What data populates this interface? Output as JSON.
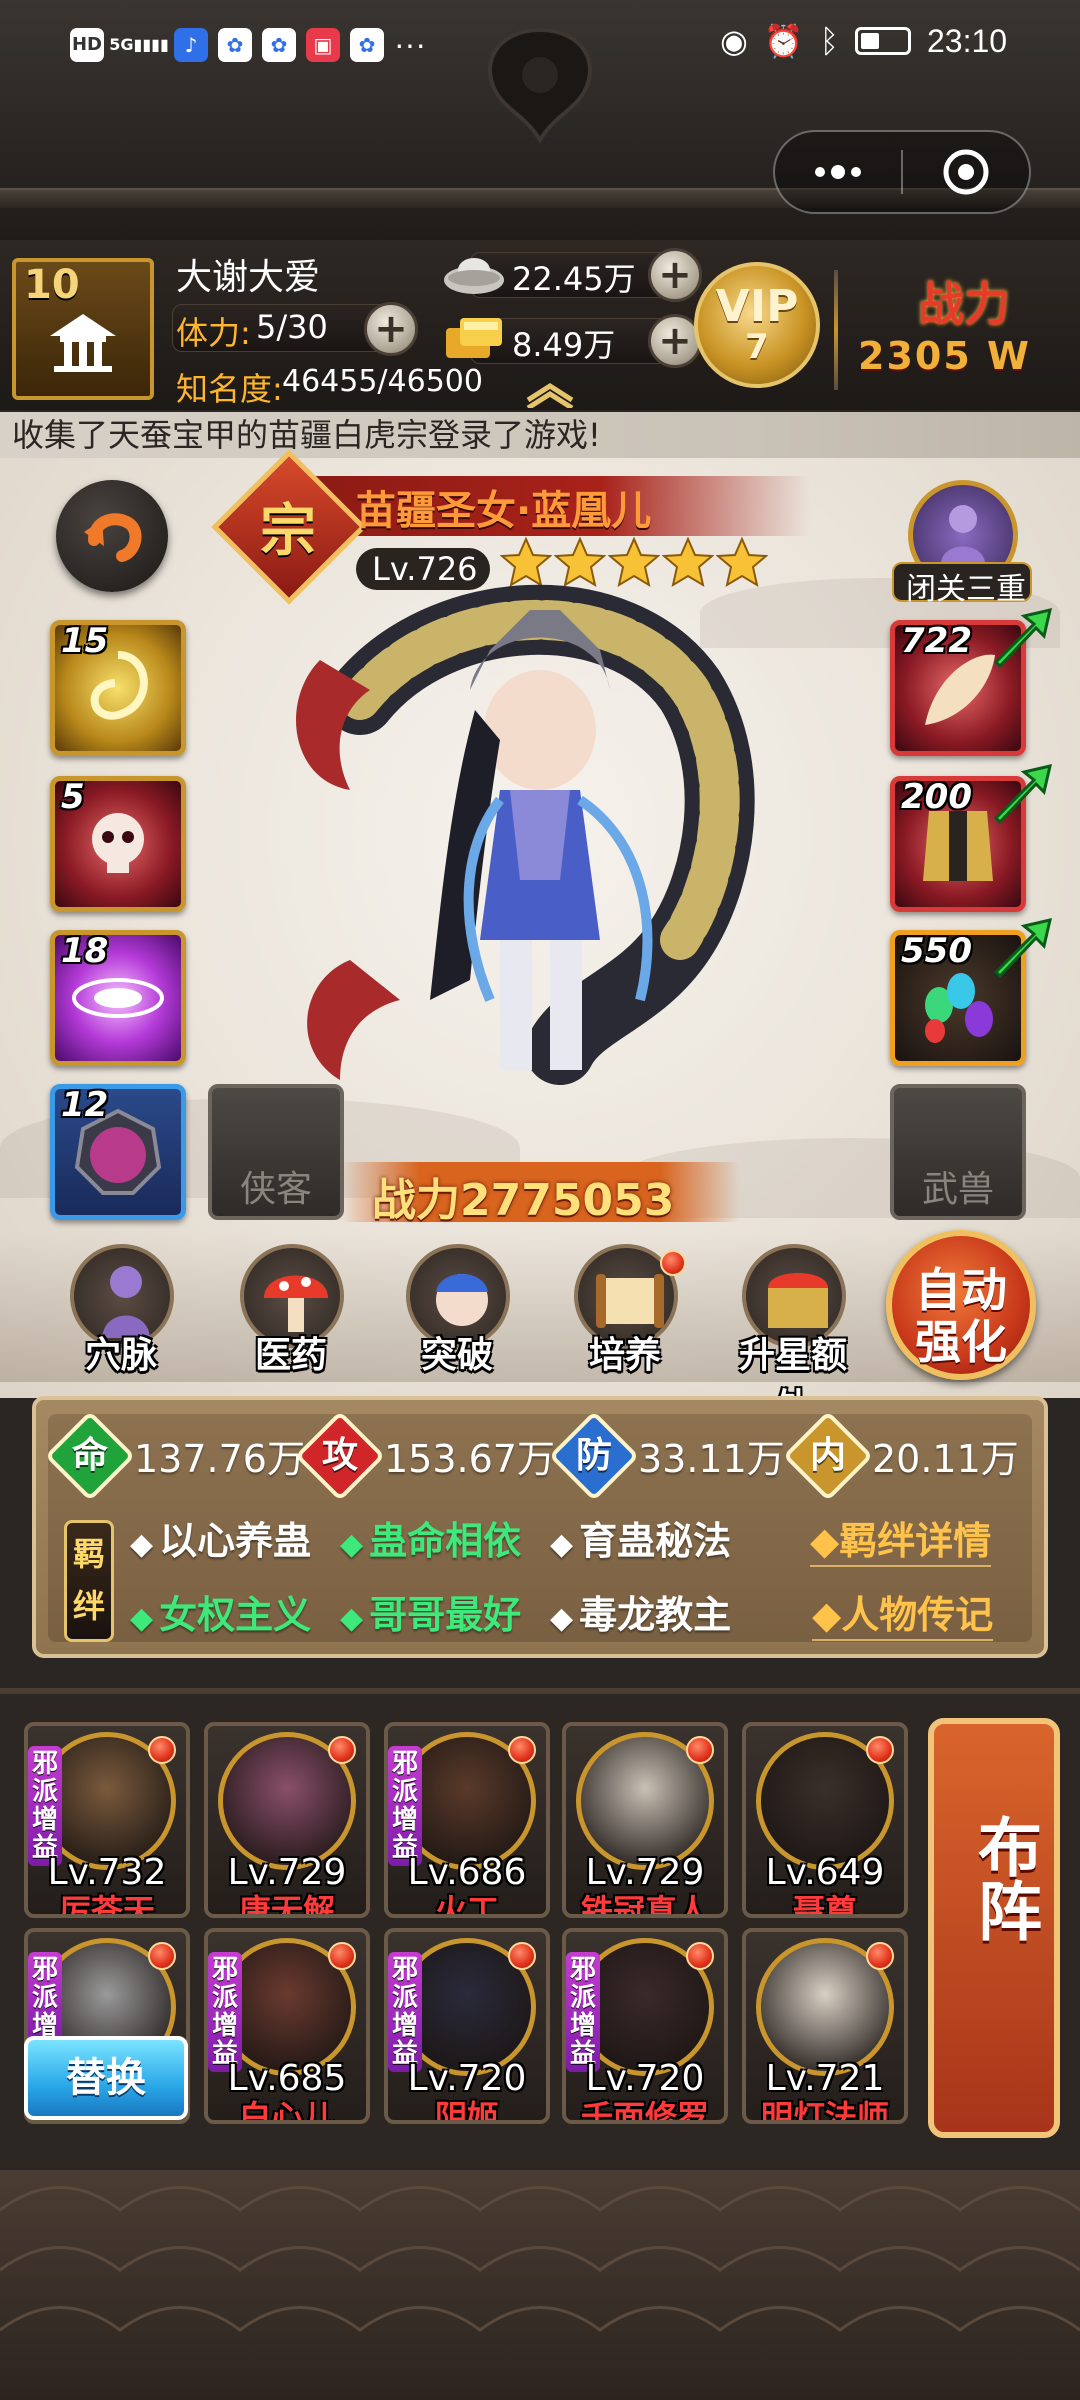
{
  "status_bar": {
    "time": "23:10",
    "left_icons": [
      "hd-icon",
      "signal-5g-icon",
      "music-app-icon",
      "baidu-paw-icon",
      "baidu-paw-icon",
      "red-app-icon",
      "baidu-paw-icon"
    ],
    "more": "···",
    "right_icons": [
      "eye-icon",
      "alarm-icon",
      "bluetooth-icon",
      "battery-icon"
    ]
  },
  "capsule": {
    "menu_icon": "more-dots-icon",
    "close_icon": "target-close-icon"
  },
  "player": {
    "level": "10",
    "name": "大谢大爱",
    "stamina_label": "体力:",
    "stamina_value": "5/30",
    "fame_label": "知名度:",
    "fame_value": "46455/46500",
    "silver": "22.45万",
    "gold": "8.49万",
    "vip_label": "VIP",
    "vip_level": "7",
    "power_label": "战力",
    "power_value": "2305 W"
  },
  "notice": "收集了天蚕宝甲的苗疆白虎宗登录了游戏!",
  "hero": {
    "badge": "宗",
    "name": "苗疆圣女·蓝凰儿",
    "level": "Lv.726",
    "stars": 5,
    "rank_label": "闭关三重",
    "power": "战力2775053"
  },
  "skills": [
    {
      "level": "15",
      "icon": "gold-swirl-icon"
    },
    {
      "level": "5",
      "icon": "skull-icon"
    },
    {
      "level": "18",
      "icon": "purple-vortex-icon"
    },
    {
      "level": "12",
      "icon": "purple-gem-medallion-icon"
    }
  ],
  "empty_slots": {
    "companion": "侠客",
    "beast": "武兽"
  },
  "equipment": [
    {
      "level": "722",
      "icon": "feather-weapon-icon"
    },
    {
      "level": "200",
      "icon": "golden-armor-icon"
    },
    {
      "level": "550",
      "icon": "gems-icon"
    }
  ],
  "features": [
    {
      "label": "穴脉",
      "icon": "meridian-figure-icon",
      "dot": false
    },
    {
      "label": "医药",
      "icon": "mushroom-icon",
      "dot": false
    },
    {
      "label": "突破",
      "icon": "warrior-head-icon",
      "dot": false
    },
    {
      "label": "培养",
      "icon": "scroll-icon",
      "dot": true
    },
    {
      "label": "升星额外",
      "icon": "treasure-icon",
      "dot": false
    }
  ],
  "auto_strengthen": {
    "line1": "自动",
    "line2": "强化"
  },
  "stats": [
    {
      "char": "命",
      "value": "137.76万",
      "color": "#1fa33a"
    },
    {
      "char": "攻",
      "value": "153.67万",
      "color": "#d0262a"
    },
    {
      "char": "防",
      "value": "33.11万",
      "color": "#2a6fd0"
    },
    {
      "char": "内",
      "value": "20.11万",
      "color": "#c9962e"
    }
  ],
  "bonds": {
    "label": "羁绊",
    "row1": [
      {
        "text": "以心养蛊",
        "color": "#ffffff"
      },
      {
        "text": "蛊命相依",
        "color": "#3ee87a"
      },
      {
        "text": "育蛊秘法",
        "color": "#ffffff"
      }
    ],
    "row2": [
      {
        "text": "女权主义",
        "color": "#3ee87a"
      },
      {
        "text": "哥哥最好",
        "color": "#3ee87a"
      },
      {
        "text": "毒龙教主",
        "color": "#ffffff"
      }
    ],
    "detail_link": "◆羁绊详情",
    "bio_link": "◆人物传记"
  },
  "team": {
    "row1": [
      {
        "level": "Lv.732",
        "name": "厉苍天",
        "tag": "邪派增益",
        "portrait": "#7a5a3c"
      },
      {
        "level": "Lv.729",
        "name": "唐无解",
        "tag": "",
        "portrait": "#8a4f6a"
      },
      {
        "level": "Lv.686",
        "name": "火工",
        "tag": "邪派增益",
        "portrait": "#5a3a2a"
      },
      {
        "level": "Lv.729",
        "name": "铁冠真人",
        "tag": "",
        "portrait": "#c9c1b5"
      },
      {
        "level": "Lv.649",
        "name": "聂尊",
        "tag": "",
        "portrait": "#3a2f2a"
      }
    ],
    "row2": [
      {
        "level": "",
        "name": "",
        "tag": "邪派增",
        "portrait": "#9a9a9a"
      },
      {
        "level": "Lv.685",
        "name": "白心儿",
        "tag": "邪派增益",
        "portrait": "#6a3a30"
      },
      {
        "level": "Lv.720",
        "name": "阴姬",
        "tag": "邪派增益",
        "portrait": "#2a2a3a"
      },
      {
        "level": "Lv.720",
        "name": "千面修罗",
        "tag": "邪派增益",
        "portrait": "#3a2a2a"
      },
      {
        "level": "Lv.721",
        "name": "明灯法师",
        "tag": "",
        "portrait": "#d8d0c4"
      }
    ],
    "replace_button": "替换",
    "formation_button": "布阵"
  }
}
